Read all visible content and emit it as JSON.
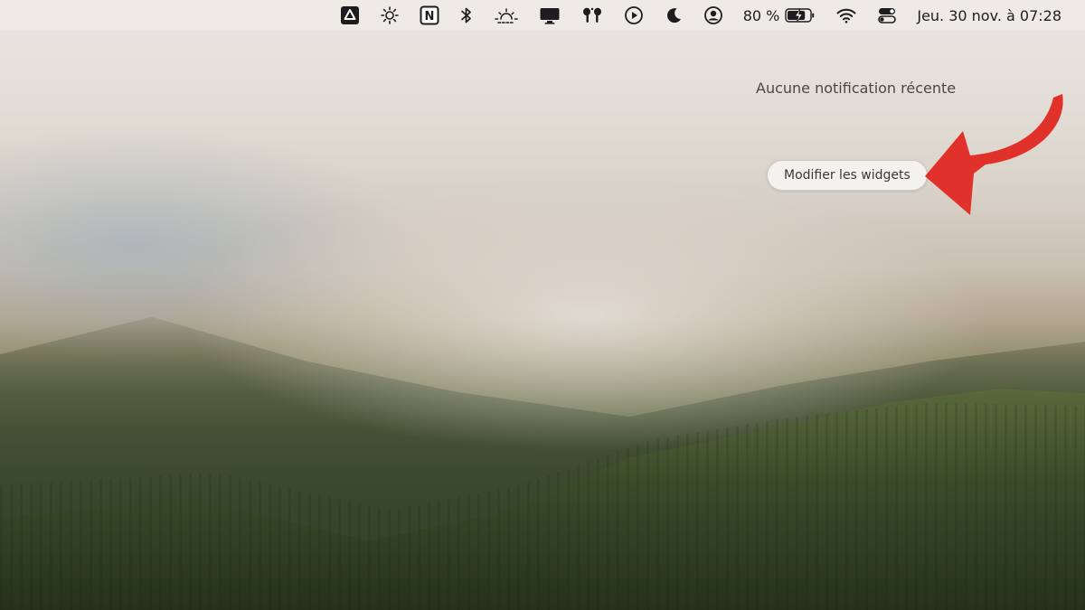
{
  "menubar": {
    "icons": [
      {
        "name": "google-drive-icon"
      },
      {
        "name": "brightness-icon"
      },
      {
        "name": "notion-icon",
        "glyph": "N"
      },
      {
        "name": "bluetooth-icon"
      },
      {
        "name": "night-shift-icon"
      },
      {
        "name": "display-icon"
      },
      {
        "name": "airpods-icon"
      },
      {
        "name": "now-playing-icon"
      },
      {
        "name": "focus-moon-icon"
      },
      {
        "name": "user-account-icon"
      }
    ],
    "battery_percent": "80 %",
    "battery_level": 0.8,
    "datetime": "Jeu. 30 nov. à 07:28"
  },
  "notifications": {
    "empty_message": "Aucune notification récente",
    "edit_widgets_label": "Modifier les widgets"
  },
  "annotation": {
    "arrow_color": "#e0322a"
  }
}
